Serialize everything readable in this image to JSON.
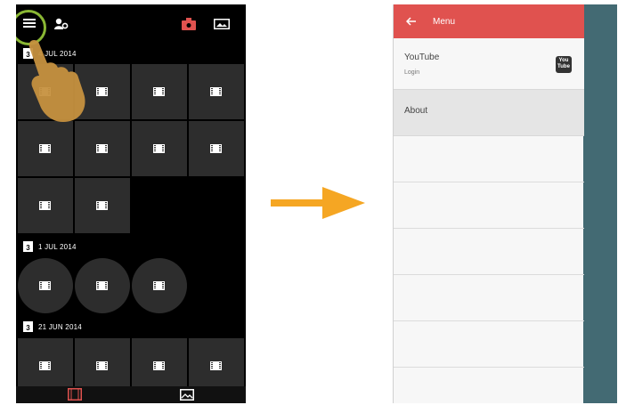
{
  "left_screen": {
    "groups": [
      {
        "date": "4 JUL 2014",
        "calendar_day": "3"
      },
      {
        "date": "1 JUL 2014",
        "calendar_day": "3"
      },
      {
        "date": "21 JUN 2014",
        "calendar_day": "3"
      }
    ]
  },
  "right_screen": {
    "menu_title": "Menu",
    "items": [
      {
        "label": "YouTube",
        "sublabel": "Login",
        "logo_text_top": "You",
        "logo_text_bottom": "Tube"
      },
      {
        "label": "About"
      }
    ]
  },
  "colors": {
    "accent_red": "#e0524f",
    "highlight_green": "#8ab734",
    "arrow_orange": "#f5a623",
    "overlay_teal": "#436a73"
  }
}
